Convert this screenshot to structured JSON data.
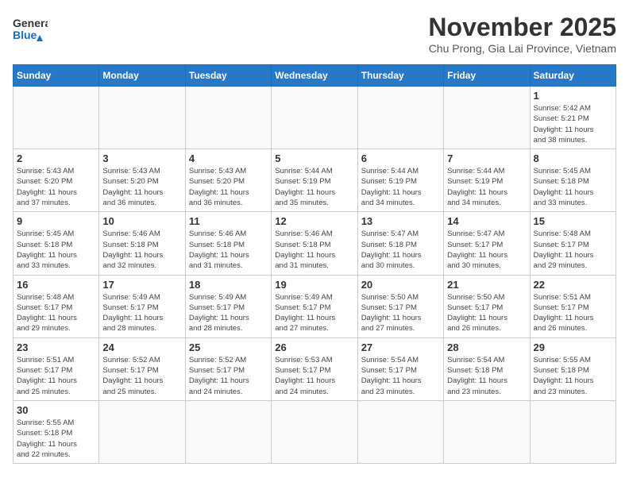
{
  "header": {
    "logo_general": "General",
    "logo_blue": "Blue",
    "month_title": "November 2025",
    "location": "Chu Prong, Gia Lai Province, Vietnam"
  },
  "weekdays": [
    "Sunday",
    "Monday",
    "Tuesday",
    "Wednesday",
    "Thursday",
    "Friday",
    "Saturday"
  ],
  "days": [
    {
      "num": "",
      "info": ""
    },
    {
      "num": "",
      "info": ""
    },
    {
      "num": "",
      "info": ""
    },
    {
      "num": "",
      "info": ""
    },
    {
      "num": "",
      "info": ""
    },
    {
      "num": "",
      "info": ""
    },
    {
      "num": "1",
      "info": "Sunrise: 5:42 AM\nSunset: 5:21 PM\nDaylight: 11 hours\nand 38 minutes."
    },
    {
      "num": "2",
      "info": "Sunrise: 5:43 AM\nSunset: 5:20 PM\nDaylight: 11 hours\nand 37 minutes."
    },
    {
      "num": "3",
      "info": "Sunrise: 5:43 AM\nSunset: 5:20 PM\nDaylight: 11 hours\nand 36 minutes."
    },
    {
      "num": "4",
      "info": "Sunrise: 5:43 AM\nSunset: 5:20 PM\nDaylight: 11 hours\nand 36 minutes."
    },
    {
      "num": "5",
      "info": "Sunrise: 5:44 AM\nSunset: 5:19 PM\nDaylight: 11 hours\nand 35 minutes."
    },
    {
      "num": "6",
      "info": "Sunrise: 5:44 AM\nSunset: 5:19 PM\nDaylight: 11 hours\nand 34 minutes."
    },
    {
      "num": "7",
      "info": "Sunrise: 5:44 AM\nSunset: 5:19 PM\nDaylight: 11 hours\nand 34 minutes."
    },
    {
      "num": "8",
      "info": "Sunrise: 5:45 AM\nSunset: 5:18 PM\nDaylight: 11 hours\nand 33 minutes."
    },
    {
      "num": "9",
      "info": "Sunrise: 5:45 AM\nSunset: 5:18 PM\nDaylight: 11 hours\nand 33 minutes."
    },
    {
      "num": "10",
      "info": "Sunrise: 5:46 AM\nSunset: 5:18 PM\nDaylight: 11 hours\nand 32 minutes."
    },
    {
      "num": "11",
      "info": "Sunrise: 5:46 AM\nSunset: 5:18 PM\nDaylight: 11 hours\nand 31 minutes."
    },
    {
      "num": "12",
      "info": "Sunrise: 5:46 AM\nSunset: 5:18 PM\nDaylight: 11 hours\nand 31 minutes."
    },
    {
      "num": "13",
      "info": "Sunrise: 5:47 AM\nSunset: 5:18 PM\nDaylight: 11 hours\nand 30 minutes."
    },
    {
      "num": "14",
      "info": "Sunrise: 5:47 AM\nSunset: 5:17 PM\nDaylight: 11 hours\nand 30 minutes."
    },
    {
      "num": "15",
      "info": "Sunrise: 5:48 AM\nSunset: 5:17 PM\nDaylight: 11 hours\nand 29 minutes."
    },
    {
      "num": "16",
      "info": "Sunrise: 5:48 AM\nSunset: 5:17 PM\nDaylight: 11 hours\nand 29 minutes."
    },
    {
      "num": "17",
      "info": "Sunrise: 5:49 AM\nSunset: 5:17 PM\nDaylight: 11 hours\nand 28 minutes."
    },
    {
      "num": "18",
      "info": "Sunrise: 5:49 AM\nSunset: 5:17 PM\nDaylight: 11 hours\nand 28 minutes."
    },
    {
      "num": "19",
      "info": "Sunrise: 5:49 AM\nSunset: 5:17 PM\nDaylight: 11 hours\nand 27 minutes."
    },
    {
      "num": "20",
      "info": "Sunrise: 5:50 AM\nSunset: 5:17 PM\nDaylight: 11 hours\nand 27 minutes."
    },
    {
      "num": "21",
      "info": "Sunrise: 5:50 AM\nSunset: 5:17 PM\nDaylight: 11 hours\nand 26 minutes."
    },
    {
      "num": "22",
      "info": "Sunrise: 5:51 AM\nSunset: 5:17 PM\nDaylight: 11 hours\nand 26 minutes."
    },
    {
      "num": "23",
      "info": "Sunrise: 5:51 AM\nSunset: 5:17 PM\nDaylight: 11 hours\nand 25 minutes."
    },
    {
      "num": "24",
      "info": "Sunrise: 5:52 AM\nSunset: 5:17 PM\nDaylight: 11 hours\nand 25 minutes."
    },
    {
      "num": "25",
      "info": "Sunrise: 5:52 AM\nSunset: 5:17 PM\nDaylight: 11 hours\nand 24 minutes."
    },
    {
      "num": "26",
      "info": "Sunrise: 5:53 AM\nSunset: 5:17 PM\nDaylight: 11 hours\nand 24 minutes."
    },
    {
      "num": "27",
      "info": "Sunrise: 5:54 AM\nSunset: 5:17 PM\nDaylight: 11 hours\nand 23 minutes."
    },
    {
      "num": "28",
      "info": "Sunrise: 5:54 AM\nSunset: 5:18 PM\nDaylight: 11 hours\nand 23 minutes."
    },
    {
      "num": "29",
      "info": "Sunrise: 5:55 AM\nSunset: 5:18 PM\nDaylight: 11 hours\nand 23 minutes."
    },
    {
      "num": "30",
      "info": "Sunrise: 5:55 AM\nSunset: 5:18 PM\nDaylight: 11 hours\nand 22 minutes."
    }
  ]
}
